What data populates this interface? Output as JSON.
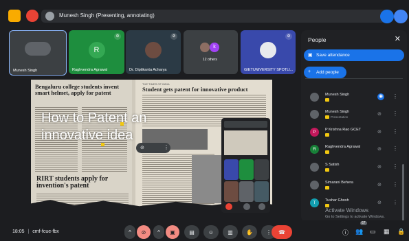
{
  "header": {
    "presenting_text": "Munesh Singh (Presenting, annotating)"
  },
  "tiles": [
    {
      "name": "Munesh Singh"
    },
    {
      "name": "Raghvendra Agrawal",
      "initial": "R"
    },
    {
      "name": "Dr. Diptikanta Acharya"
    },
    {
      "name": "",
      "count_label": "12 others",
      "extra_initial": "k"
    },
    {
      "name": "GIETUNIVERSITY SPOTLI..."
    }
  ],
  "stage": {
    "left_headline": "Bengaluru college students invent smart helmet, apply for patent",
    "left_headline2": "RIRT students apply for invention's patent",
    "right_publication": "THE TIMES OF INDIA",
    "right_headline": "Student gets patent for innovative product",
    "overlay_title_line1": "How to Patent an",
    "overlay_title_line2": "innovative idea"
  },
  "people_panel": {
    "title": "People",
    "save_attendance": "Save attendance",
    "add_people": "Add people",
    "participants": [
      {
        "name": "Munesh Singh",
        "color": "#5f6368"
      },
      {
        "name": "Munesh Singh",
        "sub": "Presentation",
        "color": "#5f6368"
      },
      {
        "name": "P Krishna Rao GCET",
        "initial": "P",
        "color": "#c2185b"
      },
      {
        "name": "Raghvendra Agrawal",
        "initial": "R",
        "color": "#188038"
      },
      {
        "name": "S Satish",
        "color": "#5f6368"
      },
      {
        "name": "Simarani Behera",
        "color": "#5f6368"
      },
      {
        "name": "Tushar Ghosh",
        "initial": "T",
        "color": "#129eaf"
      }
    ]
  },
  "watermark": {
    "line1": "Activate Windows",
    "line2": "Go to Settings to activate Windows."
  },
  "bottombar": {
    "time": "18:05",
    "separator": "|",
    "meeting_code": "cmf-fcue-fbx",
    "people_count": "67"
  },
  "colors": {
    "accent": "#1a73e8",
    "end_call": "#ea4335",
    "muted": "#f28b82"
  }
}
